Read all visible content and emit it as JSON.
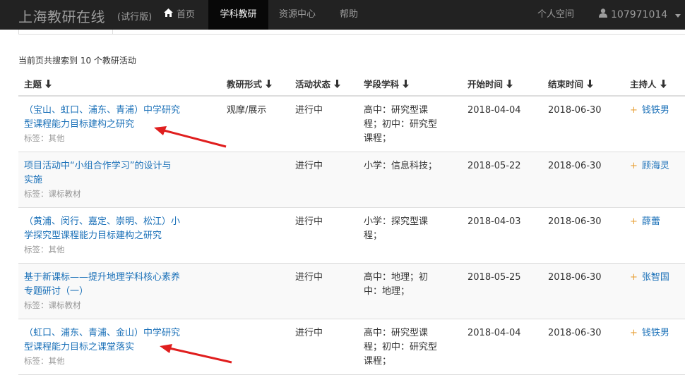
{
  "navbar": {
    "brand": "上海教研在线",
    "trial": "(试行版)",
    "items": [
      {
        "label": "首页",
        "icon": "home-icon"
      },
      {
        "label": "学科教研",
        "active": true
      },
      {
        "label": "资源中心"
      },
      {
        "label": "帮助"
      }
    ],
    "personal_space": "个人空间",
    "user": "107971014"
  },
  "summary": "当前页共搜索到 10 个教研活动",
  "columns": [
    "主题",
    "教研形式",
    "活动状态",
    "学段学科",
    "开始时间",
    "结束时间",
    "主持人"
  ],
  "rows": [
    {
      "title": [
        "（宝山、虹口、浦东、青浦）中学研究",
        "型课程能力目标建构之研究"
      ],
      "tag": "标签：其他",
      "form": "观摩/展示",
      "status": "进行中",
      "subject": [
        "高中：研究型课",
        "程；初中：研究型",
        "课程；"
      ],
      "start": "2018-04-04",
      "end": "2018-06-30",
      "host": "钱铁男"
    },
    {
      "title": [
        "项目活动中“小组合作学习”的设计与",
        "实施"
      ],
      "tag": "标签：课标教材",
      "form": "",
      "status": "进行中",
      "subject": [
        "小学：信息科技；"
      ],
      "start": "2018-05-22",
      "end": "2018-06-30",
      "host": "顾海灵"
    },
    {
      "title": [
        "（黄浦、闵行、嘉定、崇明、松江）小",
        "学探究型课程能力目标建构之研究"
      ],
      "tag": "标签：其他",
      "form": "",
      "status": "进行中",
      "subject": [
        "小学：探究型课",
        "程；"
      ],
      "start": "2018-04-03",
      "end": "2018-06-30",
      "host": "薛蕾"
    },
    {
      "title": [
        "基于新课标——提升地理学科核心素养",
        "专题研讨（一）"
      ],
      "tag": "标签：课标教材",
      "form": "",
      "status": "进行中",
      "subject": [
        "高中：地理；初",
        "中：地理；"
      ],
      "start": "2018-05-25",
      "end": "2018-06-30",
      "host": "张智国"
    },
    {
      "title": [
        "（虹口、浦东、青浦、金山）中学研究",
        "型课程能力目标之课堂落实"
      ],
      "tag": "标签：其他",
      "form": "",
      "status": "进行中",
      "subject": [
        "高中：研究型课",
        "程；初中：研究型",
        "课程；"
      ],
      "start": "2018-04-04",
      "end": "2018-06-30",
      "host": "钱铁男"
    }
  ],
  "colors": {
    "navbar": "#222222",
    "link": "#1a70b8",
    "annotation_arrow": "#e01e1e",
    "plus": "#e8a23a"
  }
}
